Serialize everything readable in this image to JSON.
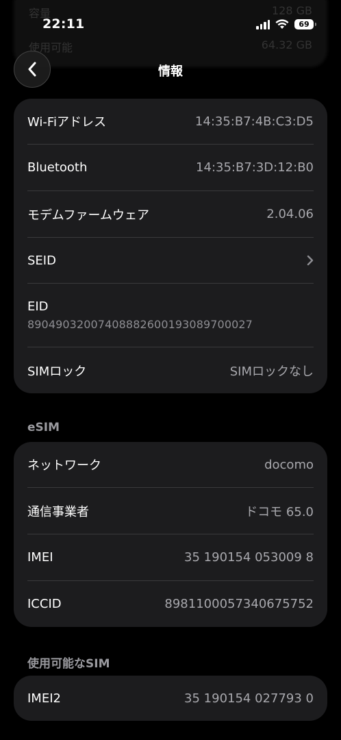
{
  "status": {
    "time": "22:11",
    "battery": "69"
  },
  "ghost": {
    "row1_label": "容量",
    "row1_value": "128 GB",
    "row2_label": "使用可能",
    "row2_value": "64.32 GB"
  },
  "nav": {
    "title": "情報"
  },
  "info_rows": [
    {
      "label": "Wi-Fiアドレス",
      "value": "14:35:B7:4B:C3:D5"
    },
    {
      "label": "Bluetooth",
      "value": "14:35:B7:3D:12:B0"
    },
    {
      "label": "モデムファームウェア",
      "value": "2.04.06"
    },
    {
      "label": "SEID"
    },
    {
      "label": "EID",
      "value": "89049032007408882600193089700027"
    },
    {
      "label": "SIMロック",
      "value": "SIMロックなし"
    }
  ],
  "esim": {
    "header": "eSIM",
    "rows": [
      {
        "label": "ネットワーク",
        "value": "docomo"
      },
      {
        "label": "通信事業者",
        "value": "ドコモ 65.0"
      },
      {
        "label": "IMEI",
        "value": "35 190154 053009 8"
      },
      {
        "label": "ICCID",
        "value": "8981100057340675752"
      }
    ]
  },
  "available_sim": {
    "header": "使用可能なSIM",
    "rows": [
      {
        "label": "IMEI2",
        "value": "35 190154 027793 0"
      }
    ]
  },
  "icons": {
    "back": "chevron-left-icon",
    "seid": "chevron-right-icon",
    "signal": "cellular-signal-icon",
    "wifi": "wifi-icon",
    "battery": "battery-icon"
  }
}
